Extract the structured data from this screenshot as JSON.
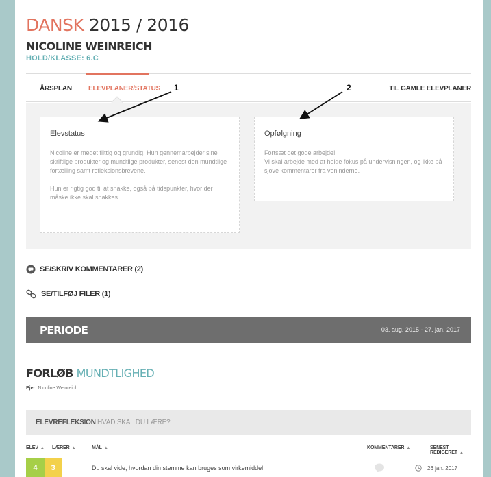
{
  "header": {
    "subject": "DANSK",
    "year": "2015 / 2016",
    "student": "NICOLINE WEINREICH",
    "class_line": "HOLD/KLASSE: 6.C"
  },
  "tabs": {
    "aarsplan": "ÅRSPLAN",
    "elevplaner": "ELEVPLANER/STATUS",
    "gamle": "TIL GAMLE ELEVPLANER"
  },
  "annotations": {
    "one": "1",
    "two": "2"
  },
  "elevstatus": {
    "title": "Elevstatus",
    "p1": "Nicoline er meget flittig og grundig. Hun gennemarbejder sine skriftlige produkter og mundtlige produkter, senest den mundtlige fortælling samt refleksionsbrevene.",
    "p2": "Hun er rigtig god til at snakke, også på tidspunkter, hvor der måske ikke skal snakkes."
  },
  "opfoelgning": {
    "title": "Opfølgning",
    "p1": "Fortsæt det gode arbejde!\nVi skal arbejde med at holde fokus på undervisningen, og ikke på sjove kommentarer fra veninderne."
  },
  "actions": {
    "comments": "SE/SKRIV KOMMENTARER (2)",
    "files": "SE/TILFØJ FILER (1)"
  },
  "periode": {
    "label": "PERIODE",
    "dates": "03. aug. 2015 - 27. jan. 2017"
  },
  "forlob": {
    "keyword": "FORLØB",
    "name": "MUNDTLIGHED",
    "owner_label": "Ejer:",
    "owner": "Nicoline Weinreich"
  },
  "elevrefleksion": {
    "keyword": "ELEVREFLEKSION",
    "question": "HVAD SKAL DU LÆRE?"
  },
  "table": {
    "headers": {
      "elev": "ELEV",
      "laerer": "LÆRER",
      "mal": "MÅL",
      "kommentarer": "KOMMENTARER",
      "senest": "SENEST REDIGERET"
    },
    "sort_glyph": "▲",
    "rows": [
      {
        "elev": "4",
        "laerer": "3",
        "mal": "Du skal vide, hvordan din stemme kan bruges som virkemiddel",
        "date": "26 jan. 2017"
      }
    ]
  },
  "colors": {
    "accent": "#e2745f",
    "teal": "#66b0b4",
    "frame": "#a9c9c9",
    "elev_score": "#a6cf48",
    "laerer_score": "#f3d14b"
  }
}
